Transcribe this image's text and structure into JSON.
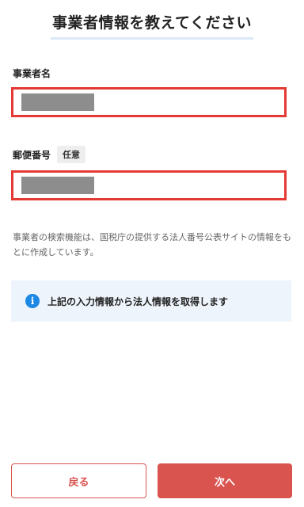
{
  "page_title": "事業者情報を教えてください",
  "business_name": {
    "label": "事業者名",
    "value": ""
  },
  "postal_code": {
    "label": "郵便番号",
    "optional_badge": "任意",
    "value": ""
  },
  "description": "事業者の検索機能は、国税庁の提供する法人番号公表サイトの情報をもとに作成しています。",
  "info": {
    "icon": "info-icon",
    "text": "上記の入力情報から法人情報を取得します"
  },
  "buttons": {
    "back": "戻る",
    "next": "次へ"
  },
  "colors": {
    "error_border": "#e53935",
    "primary": "#d9534f",
    "info_icon": "#1e88e5",
    "info_bg": "#eef4fb"
  }
}
